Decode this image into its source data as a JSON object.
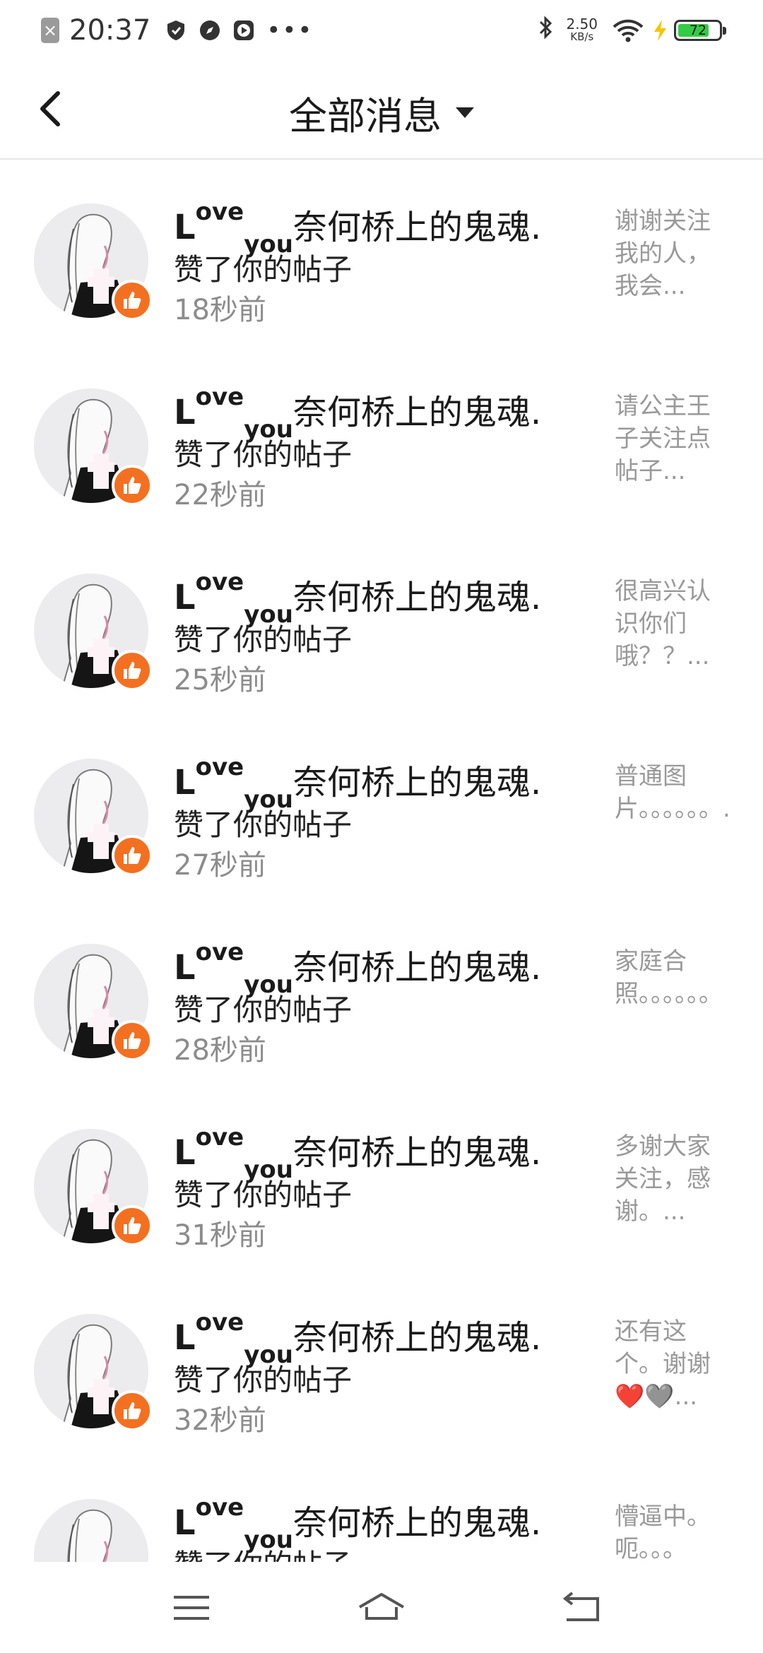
{
  "status_bar": {
    "time": "20:37",
    "net_speed_value": "2.50",
    "net_speed_unit": "KB/s",
    "battery_level": "72",
    "icons": [
      "notification-x-icon",
      "shield-icon",
      "compass-icon",
      "play-icon",
      "more-dots-icon",
      "bluetooth-icon",
      "wifi-icon",
      "charging-bolt-icon",
      "battery-icon"
    ]
  },
  "header": {
    "title": "全部消息"
  },
  "notifications": [
    {
      "name_l": "L",
      "name_ove": "ove",
      "name_you": "you",
      "name_rest": "奈何桥上的鬼魂.",
      "action": "赞了你的帖子",
      "time": "18秒前",
      "preview": "谢谢关注我的人，我会..."
    },
    {
      "name_l": "L",
      "name_ove": "ove",
      "name_you": "you",
      "name_rest": "奈何桥上的鬼魂.",
      "action": "赞了你的帖子",
      "time": "22秒前",
      "preview": "请公主王子关注点帖子..."
    },
    {
      "name_l": "L",
      "name_ove": "ove",
      "name_you": "you",
      "name_rest": "奈何桥上的鬼魂.",
      "action": "赞了你的帖子",
      "time": "25秒前",
      "preview": "很高兴认识你们哦？？..."
    },
    {
      "name_l": "L",
      "name_ove": "ove",
      "name_you": "you",
      "name_rest": "奈何桥上的鬼魂.",
      "action": "赞了你的帖子",
      "time": "27秒前",
      "preview": "普通图片。。。。。。..."
    },
    {
      "name_l": "L",
      "name_ove": "ove",
      "name_you": "you",
      "name_rest": "奈何桥上的鬼魂.",
      "action": "赞了你的帖子",
      "time": "28秒前",
      "preview": "家庭合照。。。。。。"
    },
    {
      "name_l": "L",
      "name_ove": "ove",
      "name_you": "you",
      "name_rest": "奈何桥上的鬼魂.",
      "action": "赞了你的帖子",
      "time": "31秒前",
      "preview": "多谢大家关注，感谢。..."
    },
    {
      "name_l": "L",
      "name_ove": "ove",
      "name_you": "you",
      "name_rest": "奈何桥上的鬼魂.",
      "action": "赞了你的帖子",
      "time": "32秒前",
      "preview": "还有这个。谢谢❤️🩶..."
    },
    {
      "name_l": "L",
      "name_ove": "ove",
      "name_you": "you",
      "name_rest": "奈何桥上的鬼魂.",
      "action": "赞了你的帖子",
      "time": "",
      "preview": "懵逼中。呃。。。"
    }
  ],
  "nav": {
    "icons": [
      "menu-icon",
      "home-icon",
      "back-arrow-icon"
    ]
  },
  "colors": {
    "accent": "#f37021",
    "text": "#1a1a1a",
    "muted": "#999999"
  }
}
